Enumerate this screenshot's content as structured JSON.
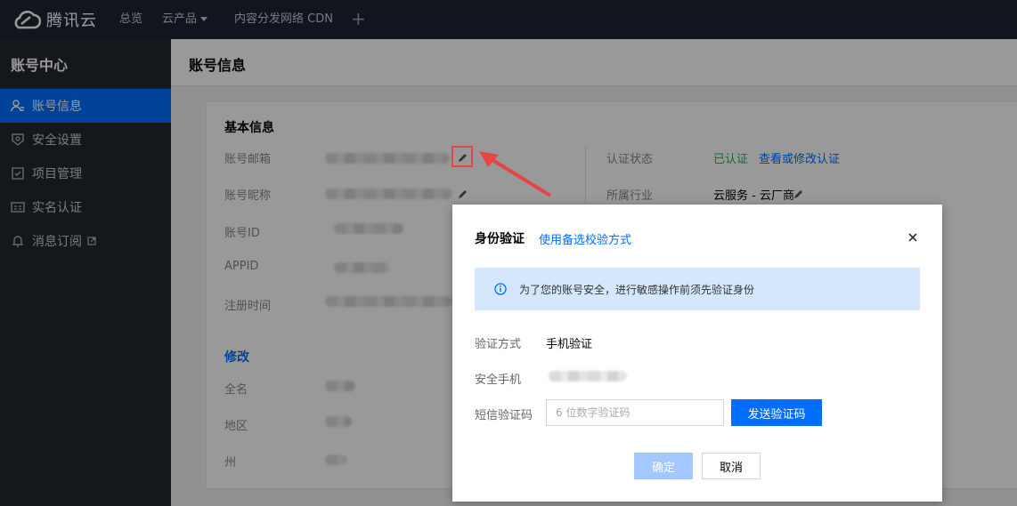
{
  "brand": {
    "name": "腾讯云",
    "accent": "#006eff",
    "logo_icon": "cloud-logo-icon"
  },
  "topnav": {
    "items": [
      {
        "label": "总览"
      },
      {
        "label": "云产品",
        "has_caret": true
      },
      {
        "label": "内容分发网络 CDN"
      }
    ],
    "add_label": "+"
  },
  "sidebar": {
    "title": "账号中心",
    "items": [
      {
        "label": "账号信息",
        "icon": "user-info-icon",
        "active": true
      },
      {
        "label": "安全设置",
        "icon": "shield-icon"
      },
      {
        "label": "项目管理",
        "icon": "checkbox-icon"
      },
      {
        "label": "实名认证",
        "icon": "id-card-icon"
      },
      {
        "label": "消息订阅",
        "icon": "bell-icon",
        "external": true
      }
    ]
  },
  "page": {
    "title": "账号信息"
  },
  "basic_info": {
    "title": "基本信息",
    "fields": [
      {
        "label": "账号邮箱"
      },
      {
        "label": "账号昵称"
      },
      {
        "label": "账号ID"
      },
      {
        "label": "APPID"
      },
      {
        "label": "注册时间"
      }
    ],
    "auth_status_label": "认证状态",
    "auth_status_value": "已认证",
    "auth_link": "查看或修改认证",
    "industry_label": "所属行业",
    "industry_value": "云服务 - 云厂商"
  },
  "modify": {
    "title": "修改",
    "fields": [
      {
        "label": "全名"
      },
      {
        "label": "地区"
      },
      {
        "label": "州"
      }
    ]
  },
  "dialog": {
    "title": "身份验证",
    "alt_link": "使用备选校验方式",
    "notice": "为了您的账号安全，进行敏感操作前须先验证身份",
    "method_label": "验证方式",
    "method_value": "手机验证",
    "phone_label": "安全手机",
    "code_label": "短信验证码",
    "code_placeholder": "6 位数字验证码",
    "code_value": "",
    "send_button": "发送验证码",
    "confirm_button": "确定",
    "cancel_button": "取消"
  },
  "colors": {
    "success": "#0abf5b",
    "highlight": "#e54545",
    "notice_bg": "#d5e7fd"
  }
}
